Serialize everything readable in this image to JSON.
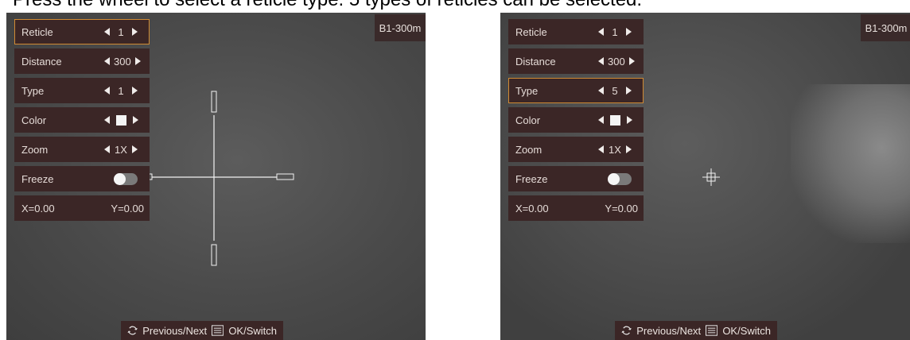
{
  "caption": "Press the wheel to select a reticle type. 5 types of reticles can be selected.",
  "screens": [
    {
      "profile": "B1-300m",
      "selected_row": "reticle",
      "menu": {
        "reticle": {
          "label": "Reticle",
          "value": "1"
        },
        "distance": {
          "label": "Distance",
          "value": "300"
        },
        "type": {
          "label": "Type",
          "value": "1"
        },
        "color": {
          "label": "Color"
        },
        "zoom": {
          "label": "Zoom",
          "value": "1X"
        },
        "freeze": {
          "label": "Freeze",
          "on": false
        },
        "coords": {
          "x": "X=0.00",
          "y": "Y=0.00"
        }
      },
      "bottom": {
        "nav": "Previous/Next",
        "ok": "OK/Switch"
      },
      "reticle_type": 1
    },
    {
      "profile": "B1-300m",
      "selected_row": "type",
      "menu": {
        "reticle": {
          "label": "Reticle",
          "value": "1"
        },
        "distance": {
          "label": "Distance",
          "value": "300"
        },
        "type": {
          "label": "Type",
          "value": "5"
        },
        "color": {
          "label": "Color"
        },
        "zoom": {
          "label": "Zoom",
          "value": "1X"
        },
        "freeze": {
          "label": "Freeze",
          "on": false
        },
        "coords": {
          "x": "X=0.00",
          "y": "Y=0.00"
        }
      },
      "bottom": {
        "nav": "Previous/Next",
        "ok": "OK/Switch"
      },
      "reticle_type": 5
    }
  ],
  "colors": {
    "accent": "#d08a33",
    "menu_bg": "#3b2626",
    "reticle": "#ffffff"
  }
}
